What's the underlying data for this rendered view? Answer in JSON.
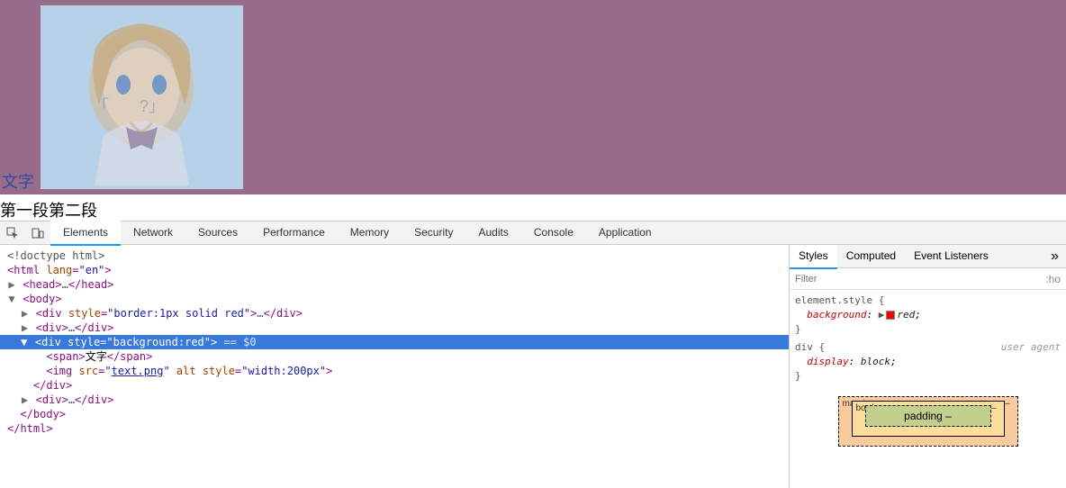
{
  "page": {
    "txt_label": "文字",
    "below": "第一段第二段"
  },
  "devtools": {
    "tabs": [
      "Elements",
      "Network",
      "Sources",
      "Performance",
      "Memory",
      "Security",
      "Audits",
      "Console",
      "Application"
    ],
    "active_tab": "Elements"
  },
  "dom": {
    "doctype": "<!doctype html>",
    "html_open": "<html lang=\"en\">",
    "head": "<head>…</head>",
    "body_open": "<body>",
    "div1_open": "<div style=\"border:1px solid red\">",
    "div1_mid": "…",
    "div1_close": "</div>",
    "div2": "<div>…</div>",
    "sel_open": "<div style=\"background:red\">",
    "sel_suffix": " == $0",
    "span_open": "<span>",
    "span_text": "文字",
    "span_close": "</span>",
    "img_pre": "<img src=\"",
    "img_src": "text.png",
    "img_post": "\" alt style=\"width:200px\">",
    "sel_close": "</div>",
    "div4": "<div>…</div>",
    "body_close": "</body>",
    "html_close": "</html>"
  },
  "side": {
    "tabs": [
      "Styles",
      "Computed",
      "Event Listeners"
    ],
    "filter_placeholder": "Filter",
    "hov": ":ho",
    "rule1_sel": "element.style {",
    "rule1_prop": "background",
    "rule1_val": "red",
    "rule1_close": "}",
    "rule2_sel": "div {",
    "rule2_ua": "user agent",
    "rule2_prop": "display",
    "rule2_val": "block",
    "rule2_close": "}",
    "bm": {
      "margin": "margin",
      "margin_v": "–",
      "border": "border",
      "border_v": "–",
      "padding": "padding –"
    }
  }
}
